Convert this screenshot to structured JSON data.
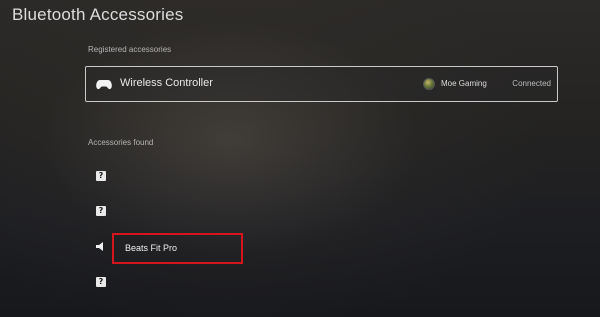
{
  "page": {
    "title": "Bluetooth Accessories"
  },
  "registered": {
    "label": "Registered accessories",
    "device": {
      "name": "Wireless Controller",
      "icon": "gamepad-icon",
      "user": "Moe Gaming",
      "status": "Connected"
    }
  },
  "found": {
    "label": "Accessories found",
    "items": [
      {
        "icon": "unknown-device-icon",
        "glyph": "?"
      },
      {
        "icon": "unknown-device-icon",
        "glyph": "?"
      },
      {
        "icon": "speaker-icon",
        "name": "Beats Fit Pro",
        "highlighted": true
      },
      {
        "icon": "unknown-device-icon",
        "glyph": "?"
      }
    ]
  },
  "colors": {
    "highlight": "#d4151b",
    "text": "#e6e6e6"
  }
}
